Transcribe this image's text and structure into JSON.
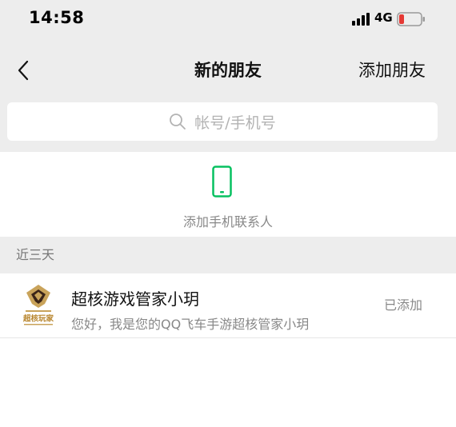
{
  "status_bar": {
    "time": "14:58",
    "network": "4G",
    "battery_color": "#e53935"
  },
  "nav": {
    "title": "新的朋友",
    "action_label": "添加朋友"
  },
  "search": {
    "placeholder": "帐号/手机号"
  },
  "add_phone": {
    "label": "添加手机联系人",
    "icon_color": "#07c160"
  },
  "recent": {
    "header": "近三天",
    "items": [
      {
        "name": "超核游戏管家小玥",
        "message": "您好，我是您的QQ飞车手游超核管家小玥",
        "status": "已添加",
        "avatar_caption": "超核玩家"
      }
    ]
  },
  "colors": {
    "background_gray": "#ededed",
    "brand_green": "#07c160",
    "avatar_gold": "#c9a35a",
    "avatar_dark": "#3a2418"
  }
}
